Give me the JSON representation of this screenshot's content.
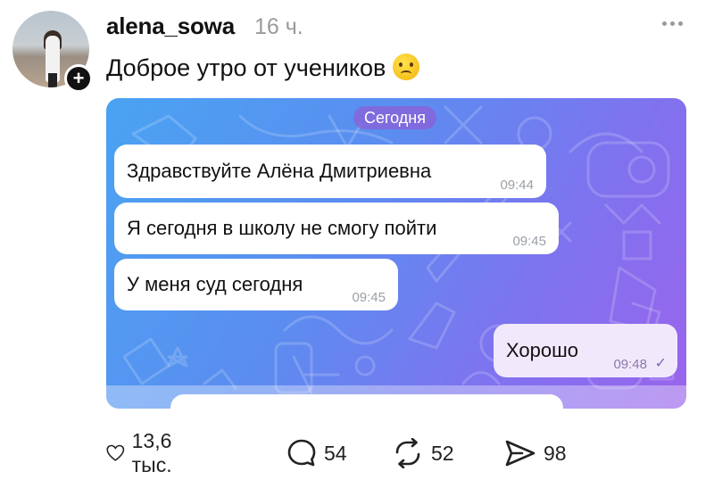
{
  "post": {
    "username": "alena_sowa",
    "time": "16 ч.",
    "text": "Доброе утро от учеников"
  },
  "chat": {
    "date_label": "Сегодня",
    "messages": [
      {
        "text": "Здравствуйте Алёна Дмитриевна",
        "time": "09:44",
        "direction": "incoming"
      },
      {
        "text": "Я сегодня в школу не смогу пойти",
        "time": "09:45",
        "direction": "incoming"
      },
      {
        "text": "У меня суд сегодня",
        "time": "09:45",
        "direction": "incoming"
      },
      {
        "text": "Хорошо",
        "time": "09:48",
        "direction": "outgoing",
        "read": true
      }
    ]
  },
  "actions": {
    "likes": "13,6 тыс.",
    "comments": "54",
    "reposts": "52",
    "shares": "98"
  },
  "icons": {
    "like": "heart-icon",
    "comment": "comment-bubble-icon",
    "repost": "repost-icon",
    "share": "send-icon",
    "more": "more-dots-icon",
    "follow": "plus-icon",
    "emoji": "smiling-face-with-tear-emoji"
  },
  "colors": {
    "chat_gradient_start": "#4aa3f2",
    "chat_gradient_end": "#9a64ec",
    "date_pill": "#8c5fd7",
    "outgoing_bubble": "#f1e9fb",
    "meta_gray": "#9a9a9a"
  }
}
